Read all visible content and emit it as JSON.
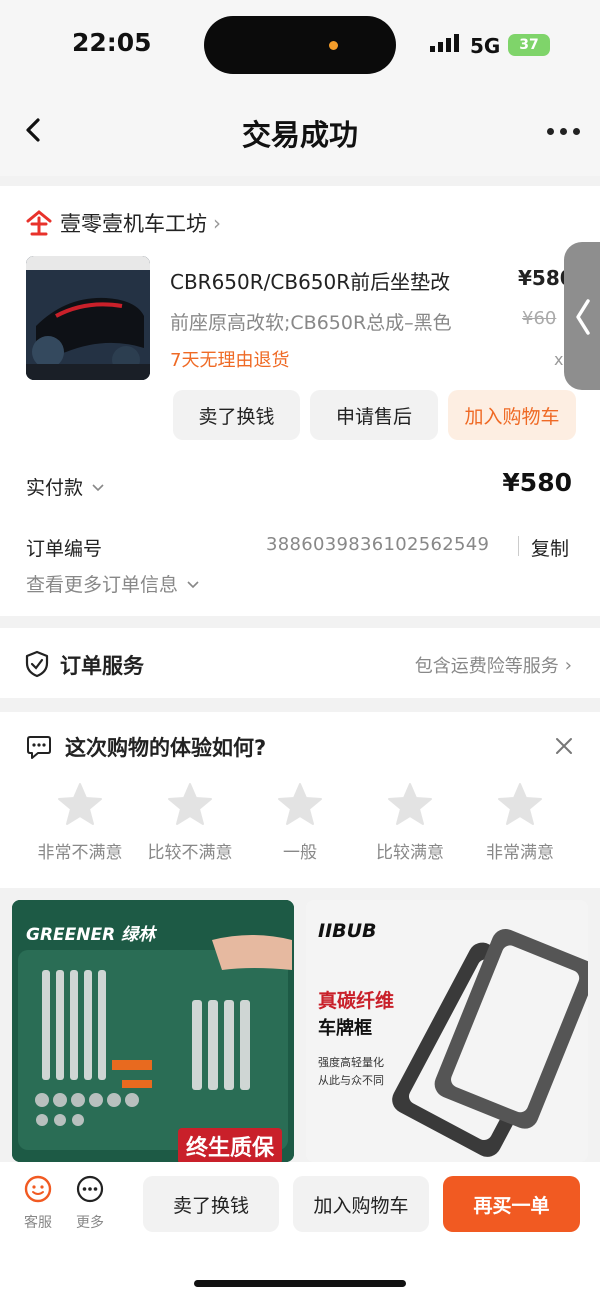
{
  "status_bar": {
    "time": "22:05",
    "network": "5G",
    "battery": "37"
  },
  "nav": {
    "title": "交易成功"
  },
  "shop": {
    "name": "壹零壹机车工坊"
  },
  "product": {
    "name": "CBR650R/CB650R前后坐垫改",
    "spec": "前座原高改软;CB650R总成–黑色",
    "note": "7天无理由退货",
    "price": "¥580",
    "original_price": "¥60",
    "qty": "x"
  },
  "actions": {
    "sell": "卖了换钱",
    "after_sale": "申请售后",
    "add_cart": "加入购物车"
  },
  "payment": {
    "label": "实付款",
    "value": "¥580"
  },
  "order": {
    "label": "订单编号",
    "number": "3886039836102562549",
    "copy": "复制",
    "more": "查看更多订单信息"
  },
  "service": {
    "title": "订单服务",
    "right": "包含运费险等服务"
  },
  "feedback": {
    "title": "这次购物的体验如何?",
    "ratings": [
      "非常不满意",
      "比较不满意",
      "一般",
      "比较满意",
      "非常满意"
    ]
  },
  "recommend": {
    "left": {
      "brand": "GREENER 绿林",
      "slogan": "终生质保"
    },
    "right": {
      "brand": "IIBUB",
      "line1": "真碳纤维",
      "line2": "车牌框",
      "line3": "强度高轻量化",
      "line4": "从此与众不同"
    }
  },
  "bottom_bar": {
    "service": "客服",
    "more": "更多",
    "sell": "卖了换钱",
    "add_cart": "加入购物车",
    "rebuy": "再买一单"
  },
  "colors": {
    "accent": "#f15a22",
    "orange_text": "#ef6a25",
    "gray_bg": "#f2f2f2"
  }
}
